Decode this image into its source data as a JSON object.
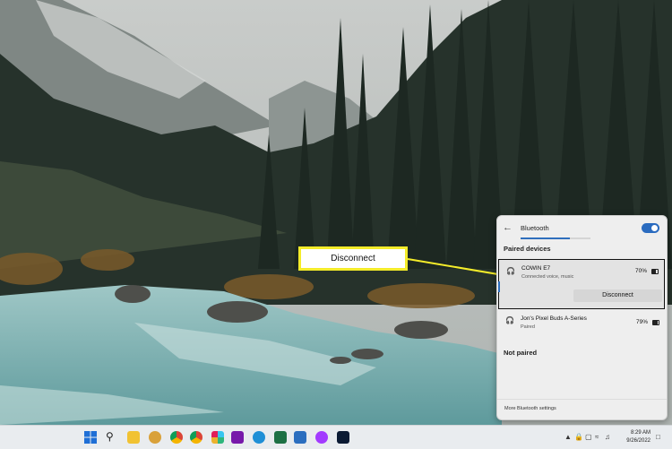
{
  "callout": {
    "label": "Disconnect"
  },
  "bluetooth_panel": {
    "title": "Bluetooth",
    "toggle_state": "on",
    "scan_progress": 0.7,
    "paired_section_label": "Paired devices",
    "not_paired_section_label": "Not paired",
    "paired_devices": [
      {
        "name": "COWIN E7",
        "status": "Connected voice, music",
        "battery": "70%",
        "battery_level": 0.7,
        "action_label": "Disconnect",
        "selected": true
      },
      {
        "name": "Jon's Pixel Buds A-Series",
        "status": "Paired",
        "battery": "79%",
        "battery_level": 0.79,
        "selected": false
      }
    ],
    "footer_link": "More Bluetooth settings"
  },
  "taskbar": {
    "apps": [
      "windows-start",
      "search",
      "file-explorer",
      "chrome-profile",
      "chrome",
      "slack",
      "onenote",
      "edge",
      "excel",
      "word",
      "messenger",
      "photoshop"
    ],
    "clock_time": "8:29 AM",
    "clock_date": "9/26/2022"
  },
  "colors": {
    "accent": "#2a6bbf",
    "callout": "#f4ec2a"
  }
}
